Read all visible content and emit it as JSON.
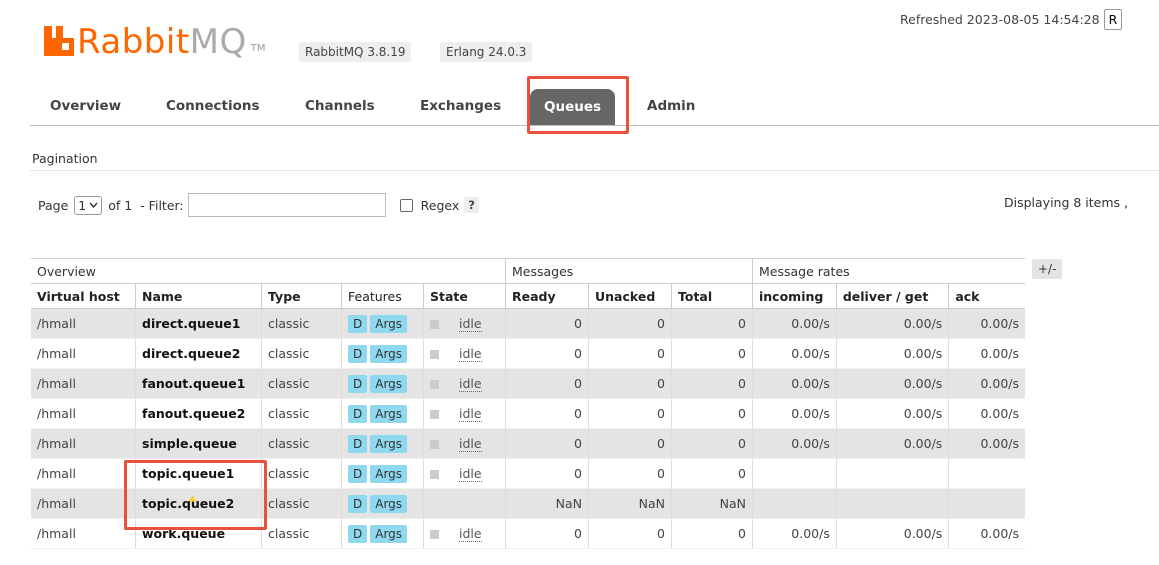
{
  "header": {
    "logo_rabbit": "Rabbit",
    "logo_mq": "MQ",
    "logo_tm": "TM",
    "rabbitmq_version": "RabbitMQ 3.8.19",
    "erlang_version": "Erlang 24.0.3",
    "refreshed": "Refreshed 2023-08-05 14:54:28",
    "refresh_control": "R"
  },
  "tabs": [
    {
      "label": "Overview",
      "active": false
    },
    {
      "label": "Connections",
      "active": false
    },
    {
      "label": "Channels",
      "active": false
    },
    {
      "label": "Exchanges",
      "active": false
    },
    {
      "label": "Queues",
      "active": true
    },
    {
      "label": "Admin",
      "active": false
    }
  ],
  "pagination": {
    "heading": "Pagination",
    "page_label": "Page",
    "page_value": "1",
    "of_label": "of 1",
    "filter_label": "- Filter:",
    "filter_value": "",
    "regex_label": "Regex",
    "regex_checked": false,
    "help": "?",
    "displaying": "Displaying 8 items ,"
  },
  "table": {
    "group_headers": {
      "overview": "Overview",
      "messages": "Messages",
      "rates": "Message rates"
    },
    "plus_minus": "+/-",
    "columns": [
      "Virtual host",
      "Name",
      "Type",
      "Features",
      "State",
      "Ready",
      "Unacked",
      "Total",
      "incoming",
      "deliver / get",
      "ack"
    ],
    "rows": [
      {
        "vhost": "/hmall",
        "name": "direct.queue1",
        "type": "classic",
        "feat_d": "D",
        "feat_args": "Args",
        "state": "idle",
        "ready": "0",
        "unacked": "0",
        "total": "0",
        "incoming": "0.00/s",
        "deliver": "0.00/s",
        "ack": "0.00/s"
      },
      {
        "vhost": "/hmall",
        "name": "direct.queue2",
        "type": "classic",
        "feat_d": "D",
        "feat_args": "Args",
        "state": "idle",
        "ready": "0",
        "unacked": "0",
        "total": "0",
        "incoming": "0.00/s",
        "deliver": "0.00/s",
        "ack": "0.00/s"
      },
      {
        "vhost": "/hmall",
        "name": "fanout.queue1",
        "type": "classic",
        "feat_d": "D",
        "feat_args": "Args",
        "state": "idle",
        "ready": "0",
        "unacked": "0",
        "total": "0",
        "incoming": "0.00/s",
        "deliver": "0.00/s",
        "ack": "0.00/s"
      },
      {
        "vhost": "/hmall",
        "name": "fanout.queue2",
        "type": "classic",
        "feat_d": "D",
        "feat_args": "Args",
        "state": "idle",
        "ready": "0",
        "unacked": "0",
        "total": "0",
        "incoming": "0.00/s",
        "deliver": "0.00/s",
        "ack": "0.00/s"
      },
      {
        "vhost": "/hmall",
        "name": "simple.queue",
        "type": "classic",
        "feat_d": "D",
        "feat_args": "Args",
        "state": "idle",
        "ready": "0",
        "unacked": "0",
        "total": "0",
        "incoming": "0.00/s",
        "deliver": "0.00/s",
        "ack": "0.00/s"
      },
      {
        "vhost": "/hmall",
        "name": "topic.queue1",
        "type": "classic",
        "feat_d": "D",
        "feat_args": "Args",
        "state": "idle",
        "ready": "0",
        "unacked": "0",
        "total": "0",
        "incoming": "",
        "deliver": "",
        "ack": ""
      },
      {
        "vhost": "/hmall",
        "name": "topic.queue2",
        "type": "classic",
        "feat_d": "D",
        "feat_args": "Args",
        "state": "",
        "ready": "NaN",
        "unacked": "NaN",
        "total": "NaN",
        "incoming": "",
        "deliver": "",
        "ack": ""
      },
      {
        "vhost": "/hmall",
        "name": "work.queue",
        "type": "classic",
        "feat_d": "D",
        "feat_args": "Args",
        "state": "idle",
        "ready": "0",
        "unacked": "0",
        "total": "0",
        "incoming": "0.00/s",
        "deliver": "0.00/s",
        "ack": "0.00/s"
      }
    ]
  }
}
